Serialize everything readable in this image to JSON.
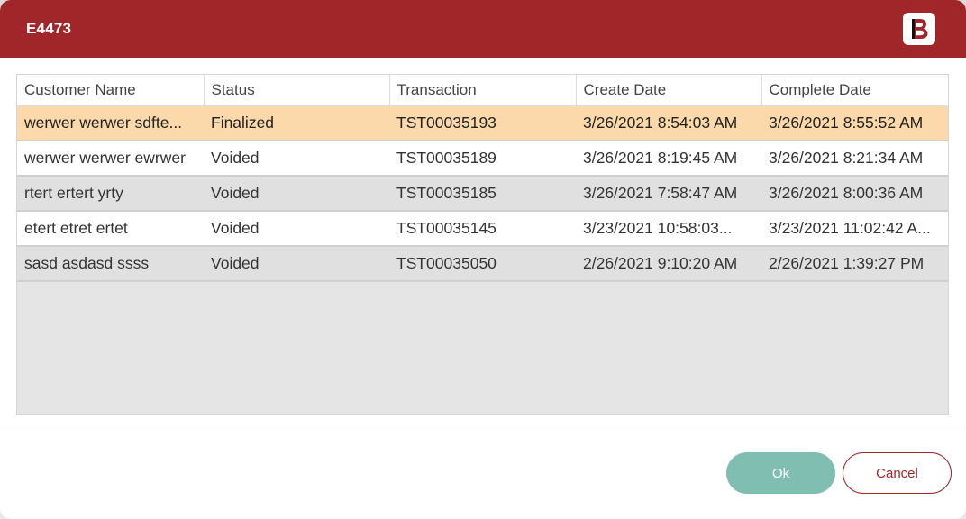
{
  "dialog": {
    "title": "E4473",
    "logo_icon": "brand-b-logo-icon"
  },
  "table": {
    "columns": [
      "Customer Name",
      "Status",
      "Transaction",
      "Create Date",
      "Complete Date"
    ],
    "rows": [
      {
        "customer": "werwer werwer sdfte...",
        "status": "Finalized",
        "transaction": "TST00035193",
        "create_date": "3/26/2021 8:54:03 AM",
        "complete_date": "3/26/2021 8:55:52 AM",
        "selected": true
      },
      {
        "customer": "werwer werwer ewrwer",
        "status": "Voided",
        "transaction": "TST00035189",
        "create_date": "3/26/2021 8:19:45 AM",
        "complete_date": "3/26/2021 8:21:34 AM"
      },
      {
        "customer": "rtert ertert yrty",
        "status": "Voided",
        "transaction": "TST00035185",
        "create_date": "3/26/2021 7:58:47 AM",
        "complete_date": "3/26/2021 8:00:36 AM"
      },
      {
        "customer": "etert etret ertet",
        "status": "Voided",
        "transaction": "TST00035145",
        "create_date": "3/23/2021 10:58:03...",
        "complete_date": "3/23/2021 11:02:42 A..."
      },
      {
        "customer": "sasd asdasd ssss",
        "status": "Voided",
        "transaction": "TST00035050",
        "create_date": "2/26/2021 9:10:20 AM",
        "complete_date": "2/26/2021 1:39:27 PM"
      }
    ]
  },
  "buttons": {
    "ok_label": "Ok",
    "cancel_label": "Cancel"
  },
  "colors": {
    "titlebar": "#a1262a",
    "selected_row": "#fcd9aa",
    "ok_button": "#7fbeb1",
    "cancel_border": "#a1262a"
  }
}
